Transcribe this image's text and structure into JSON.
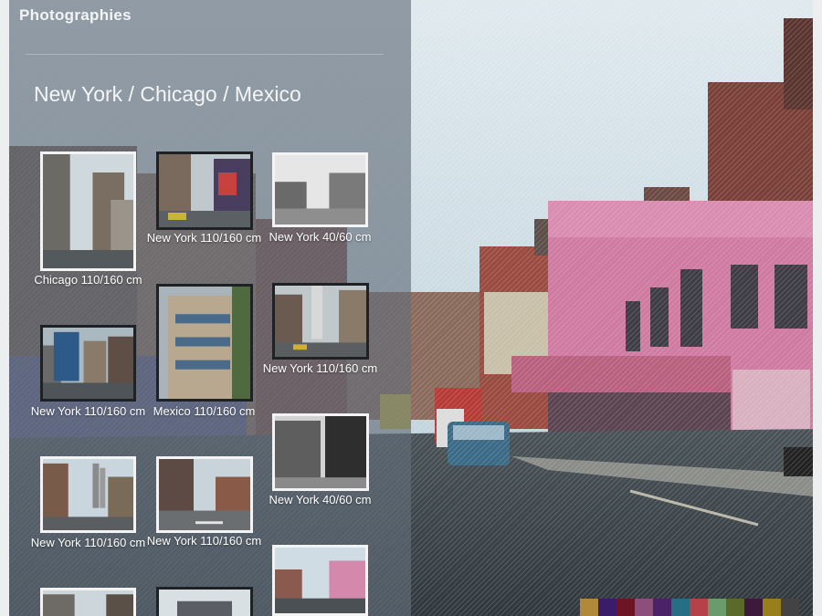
{
  "header": {
    "site_title": "Photographies"
  },
  "gallery": {
    "title": "New York / Chicago / Mexico",
    "thumbs": [
      {
        "caption": "Chicago 110/160 cm"
      },
      {
        "caption": "New York 110/160 cm"
      },
      {
        "caption": "New York 40/60 cm"
      },
      {
        "caption": "New York 110/160 cm"
      },
      {
        "caption": "Mexico 110/160 cm"
      },
      {
        "caption": "New York 110/160 cm"
      },
      {
        "caption": "New York 40/60 cm"
      },
      {
        "caption": "New York 110/160 cm"
      },
      {
        "caption": "New York 110/160 cm"
      },
      {
        "caption": ""
      },
      {
        "caption": ""
      },
      {
        "caption": ""
      }
    ]
  },
  "palette": [
    "#b0893a",
    "#3a1c6b",
    "#6e1524",
    "#8c4f7c",
    "#4b2265",
    "#266e83",
    "#b4424a",
    "#6a9b6c",
    "#5b6a2a",
    "#3d1a3c",
    "#97801c",
    "#434343"
  ],
  "colors": {
    "panel": "#626e7a",
    "sky": "#c3d6e0",
    "pink_building": "#cf7aa0"
  }
}
